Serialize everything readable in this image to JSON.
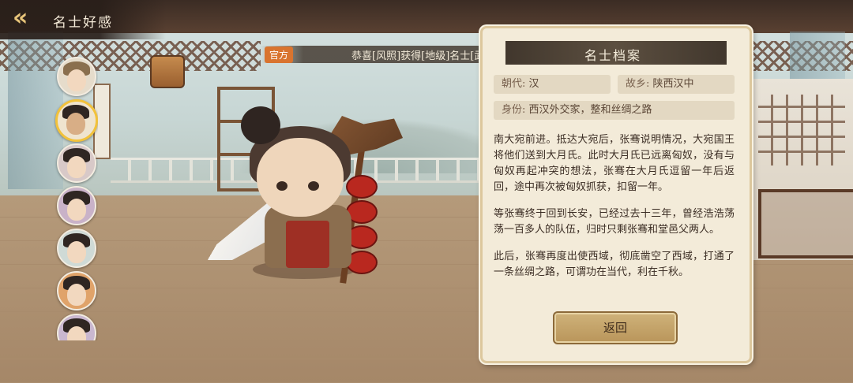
{
  "header": {
    "back_icon": "chevron-left-icon",
    "title": "名士好感"
  },
  "announcement": {
    "tag": "官方",
    "text": "恭喜[风照]获得[地级]名士[武则天]"
  },
  "portraits": [
    {
      "name": "portrait-1",
      "selected": false
    },
    {
      "name": "portrait-2",
      "selected": true
    },
    {
      "name": "portrait-3",
      "selected": false
    },
    {
      "name": "portrait-4",
      "selected": false
    },
    {
      "name": "portrait-5",
      "selected": false
    },
    {
      "name": "portrait-6",
      "selected": false
    },
    {
      "name": "portrait-7",
      "selected": false
    }
  ],
  "panel": {
    "title": "名士档案",
    "dynasty_label": "朝代:",
    "dynasty_value": "汉",
    "hometown_label": "故乡:",
    "hometown_value": "陕西汉中",
    "identity_label": "身份:",
    "identity_value": "西汉外交家，整和丝绸之路",
    "bio": [
      "南大宛前进。抵达大宛后，张骞说明情况，大宛国王将他们送到大月氏。此时大月氏已远离匈奴，没有与匈奴再起冲突的想法，张骞在大月氏逗留一年后返回，途中再次被匈奴抓获，扣留一年。",
      "等张骞终于回到长安，已经过去十三年，曾经浩浩荡荡一百多人的队伍，归时只剩张骞和堂邑父两人。",
      "此后，张骞再度出使西域，彻底凿空了西域，打通了一条丝绸之路，可谓功在当代，利在千秋。"
    ],
    "return_label": "返回"
  },
  "colors": {
    "panel_bg": "#f3ebd9",
    "header_bg": "#41372d",
    "selected_border": "#f2c23b",
    "announce_tag": "#d9742f"
  }
}
